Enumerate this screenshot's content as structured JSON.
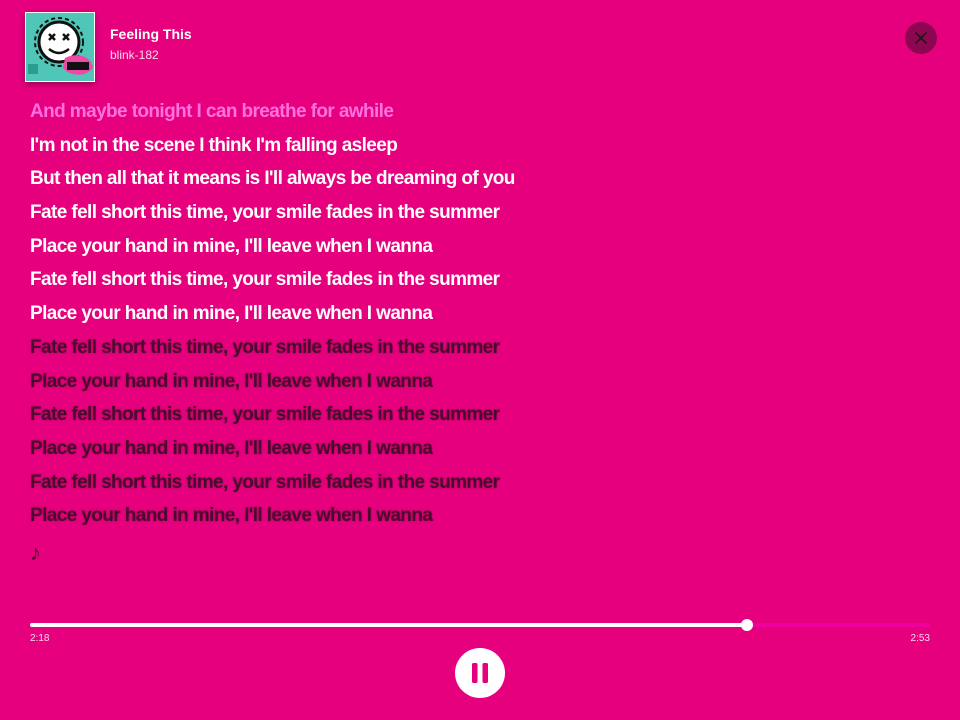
{
  "theme": {
    "background": "#e6007e",
    "past_lyric_color": "#ff71e0",
    "current_lyric_color": "#ffffff",
    "upcoming_lyric_color": "#4a0a2c",
    "close_button_color": "#8c0750",
    "progress_remaining_color": "#f0009f"
  },
  "now_playing": {
    "title": "Feeling This",
    "artist": "blink-182",
    "album_art": "blink-182 album art (smiley with X eyes)"
  },
  "header": {
    "close_icon": "close-icon"
  },
  "lyrics": {
    "lines": [
      {
        "text": "And maybe tonight I can breathe for awhile",
        "state": "past"
      },
      {
        "text": "I'm not in the scene I think I'm falling asleep",
        "state": "current"
      },
      {
        "text": "But then all that it means is I'll always be dreaming of you",
        "state": "current"
      },
      {
        "text": "Fate fell short this time, your smile fades in the summer",
        "state": "current"
      },
      {
        "text": "Place your hand in mine, I'll leave when I wanna",
        "state": "current"
      },
      {
        "text": "Fate fell short this time, your smile fades in the summer",
        "state": "current"
      },
      {
        "text": "Place your hand in mine, I'll leave when I wanna",
        "state": "current"
      },
      {
        "text": "Fate fell short this time, your smile fades in the summer",
        "state": "upcoming"
      },
      {
        "text": "Place your hand in mine, I'll leave when I wanna",
        "state": "upcoming"
      },
      {
        "text": "Fate fell short this time, your smile fades in the summer",
        "state": "upcoming"
      },
      {
        "text": "Place your hand in mine, I'll leave when I wanna",
        "state": "upcoming"
      },
      {
        "text": "Fate fell short this time, your smile fades in the summer",
        "state": "upcoming"
      },
      {
        "text": "Place your hand in mine, I'll leave when I wanna",
        "state": "upcoming"
      }
    ],
    "end_marker": "♪"
  },
  "playback": {
    "elapsed": "2:18",
    "total": "2:53",
    "progress_fraction": 0.797,
    "control_icon": "pause-icon"
  }
}
